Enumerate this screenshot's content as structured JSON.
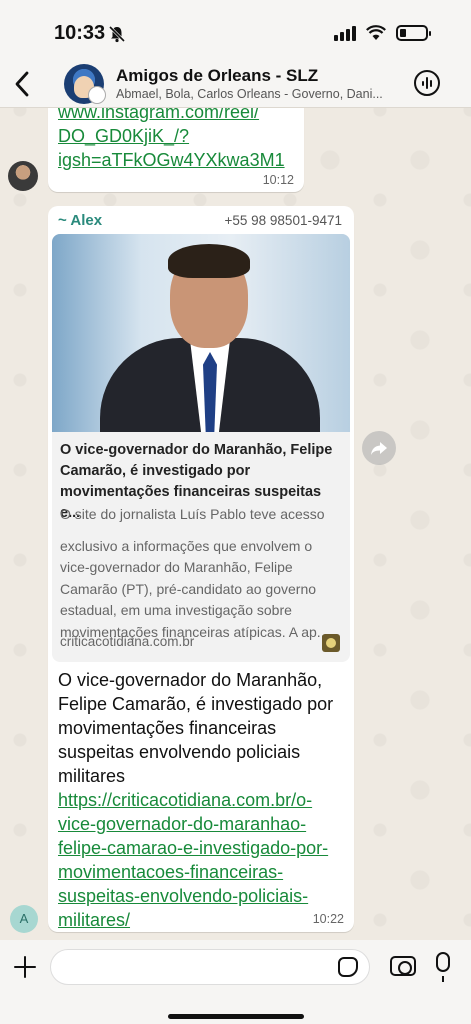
{
  "status_bar": {
    "time": "10:33"
  },
  "header": {
    "title": "Amigos de Orleans - SLZ",
    "subtitle": "Abmael, Bola, Carlos Orleans - Governo, Dani..."
  },
  "messages": [
    {
      "link_lines": [
        "www.instagram.com/reel/",
        "DO_GD0KjiK_/?",
        "igsh=aTFkOGw4YXkwa3M1"
      ],
      "time": "10:12"
    },
    {
      "sender_name": "~ Alex",
      "sender_phone": "+55 98 98501-9471",
      "preview": {
        "title": "O vice-governador do Maranhão, Felipe Camarão, é investigado por movimentações financeiras suspeitas e...",
        "description_line1": "O site do jornalista Luís Pablo teve acesso",
        "description_rest": "exclusivo a informações que envolvem o vice-governador do Maranhão, Felipe Camarão (PT), pré-candidato ao governo estadual, em uma investigação sobre movimentações financeiras atípicas. A ap...",
        "domain": "criticacotidiana.com.br"
      },
      "text": "O vice-governador do Maranhão, Felipe Camarão, é investigado por movimentações financeiras suspeitas envolvendo policiais militares",
      "url": "https://criticacotidiana.com.br/o-vice-governador-do-maranhao-felipe-camarao-e-investigado-por-movimentacoes-financeiras-suspeitas-envolvendo-policiais-militares/",
      "time": "10:22",
      "avatar_initial": "A"
    }
  ]
}
